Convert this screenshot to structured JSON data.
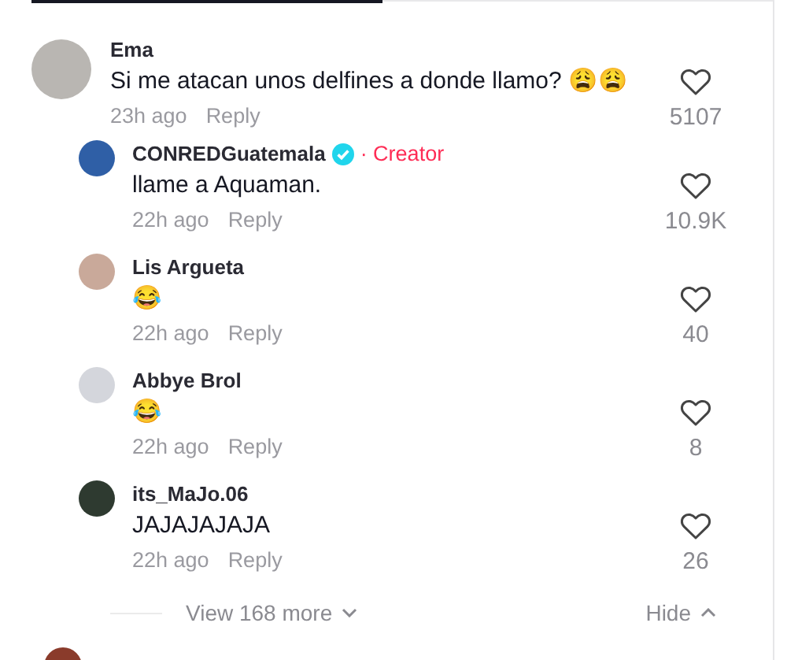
{
  "comment": {
    "author": "Ema",
    "text": "Si me atacan unos delfines a donde llamo? 😩😩",
    "time": "23h ago",
    "reply": "Reply",
    "likes": "5107",
    "replies": [
      {
        "author": "CONREDGuatemala",
        "verified": true,
        "badge": "· Creator",
        "text": "llame a Aquaman.",
        "time": "22h ago",
        "reply": "Reply",
        "likes": "10.9K"
      },
      {
        "author": "Lis Argueta",
        "verified": false,
        "text": "😂",
        "time": "22h ago",
        "reply": "Reply",
        "likes": "40"
      },
      {
        "author": "Abbye Brol",
        "verified": false,
        "text": "😂",
        "time": "22h ago",
        "reply": "Reply",
        "likes": "8"
      },
      {
        "author": "its_MaJo.06",
        "verified": false,
        "text": "JAJAJAJAJA",
        "time": "22h ago",
        "reply": "Reply",
        "likes": "26"
      }
    ]
  },
  "thread_footer": {
    "view_more": "View 168 more",
    "hide": "Hide"
  }
}
